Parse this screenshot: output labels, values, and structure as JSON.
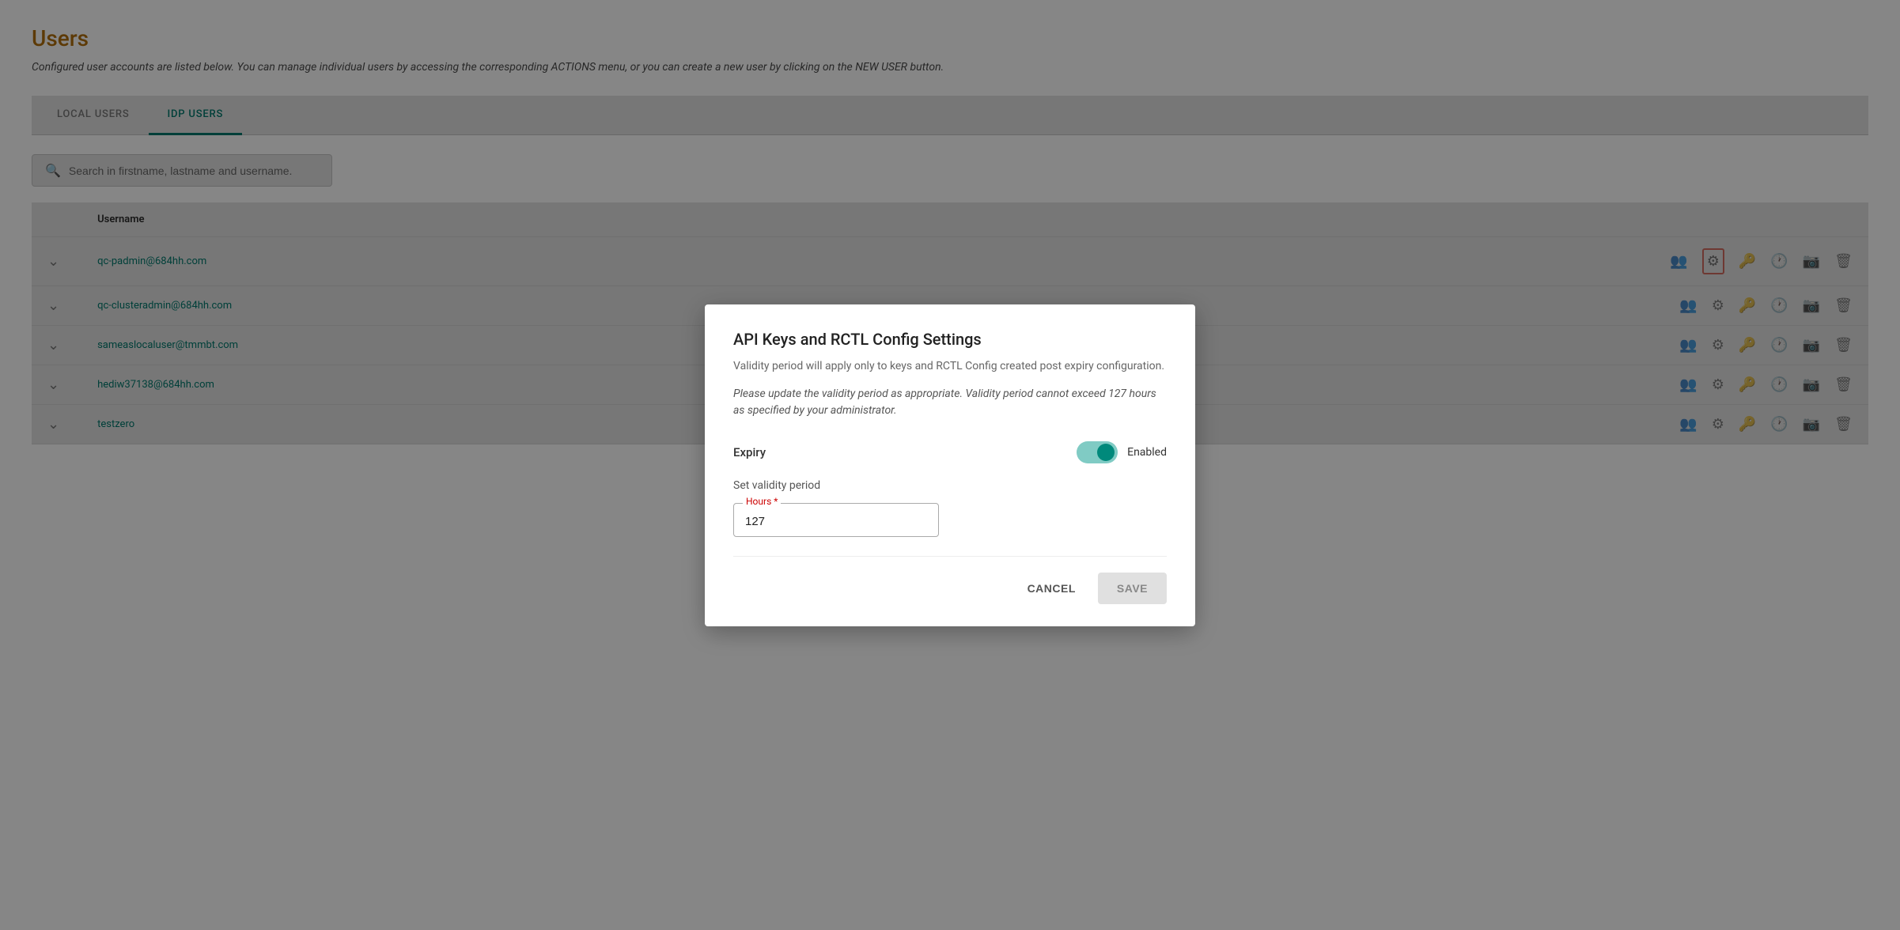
{
  "page": {
    "title": "Users",
    "subtitle": "Configured user accounts are listed below. You can manage individual users by accessing the corresponding ACTIONS menu, or you can create a new user by clicking on the NEW USER button."
  },
  "tabs": [
    {
      "id": "local-users",
      "label": "LOCAL USERS",
      "active": false
    },
    {
      "id": "idp-users",
      "label": "IDP USERS",
      "active": true
    }
  ],
  "search": {
    "placeholder": "Search in firstname, lastname and username."
  },
  "table": {
    "column_username": "Username",
    "rows": [
      {
        "username": "qc-padmin@684hh.com"
      },
      {
        "username": "qc-clusteradmin@684hh.com"
      },
      {
        "username": "sameaslocaluser@tmmbt.com"
      },
      {
        "username": "hediw37138@684hh.com"
      },
      {
        "username": "testzero"
      }
    ]
  },
  "dialog": {
    "title": "API Keys and RCTL Config Settings",
    "subtitle": "Validity period will apply only to keys and RCTL Config created post expiry configuration.",
    "note": "Please update the validity period as appropriate. Validity period cannot exceed 127 hours as specified by your administrator.",
    "expiry_label": "Expiry",
    "toggle_state": "Enabled",
    "validity_section_label": "Set validity period",
    "hours_field_label": "Hours",
    "hours_field_required": "*",
    "hours_value": "127",
    "cancel_label": "CANCEL",
    "save_label": "SAVE"
  }
}
